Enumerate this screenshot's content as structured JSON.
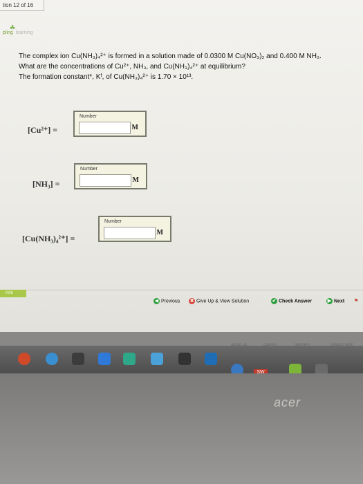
{
  "tab": {
    "label": "tion 12 of 16"
  },
  "logo": {
    "main": "pling",
    "sub": "learning"
  },
  "question": {
    "line1": "The complex ion Cu(NH₃)₄²⁺ is formed in a solution made of 0.0300 M Cu(NO₃)₂ and 0.400 M NH₃.",
    "line2": "What are the concentrations of Cu²⁺, NH₃, and Cu(NH₃)₄²⁺ at equilibrium?",
    "line3": "The formation constant*, Kᶠ, of Cu(NH₃)₄²⁺ is 1.70 × 10¹³."
  },
  "answers": [
    {
      "eq": "[Cu²⁺] =",
      "label": "Number",
      "value": "",
      "unit": "M"
    },
    {
      "eq": "[NH₃] =",
      "label": "Number",
      "value": "",
      "unit": "M"
    },
    {
      "eq": "[Cu(NH₃)₄²⁺] =",
      "label": "Number",
      "value": "",
      "unit": "M"
    }
  ],
  "nav": {
    "hint": "Hint",
    "previous": "Previous",
    "give_up": "Give Up & View Solution",
    "check": "Check Answer",
    "next": "Next"
  },
  "footer": {
    "about": "about us",
    "careers": "careers",
    "partners": "partners",
    "privacy": "privacy polic"
  },
  "sw_badge": "SW 2015",
  "brand": "acer",
  "colors": {
    "hint": "#a9c84a",
    "previous": "#2e9e3e",
    "give_up": "#d8483b",
    "check": "#2e9e3e",
    "next": "#2e9e3e"
  }
}
